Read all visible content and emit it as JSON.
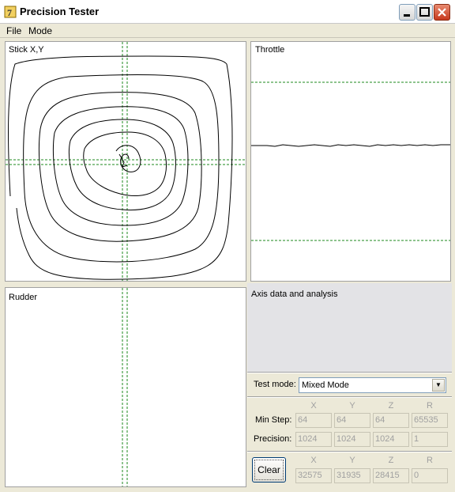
{
  "window": {
    "title": "Precision Tester"
  },
  "menu": {
    "file_label": "File",
    "mode_label": "Mode"
  },
  "panels": {
    "stick_label": "Stick X,Y",
    "throttle_label": "Throttle",
    "rudder_label": "Rudder",
    "analysis_label": "Axis data and analysis"
  },
  "test_mode": {
    "label": "Test mode:",
    "value": "Mixed Mode"
  },
  "columns": [
    "X",
    "Y",
    "Z",
    "R"
  ],
  "stats": {
    "min_step_label": "Min Step:",
    "min_step": [
      "64",
      "64",
      "64",
      "65535"
    ],
    "precision_label": "Precision:",
    "precision": [
      "1024",
      "1024",
      "1024",
      "1"
    ]
  },
  "current": {
    "clear_label": "Clear",
    "values": [
      "32575",
      "31935",
      "28415",
      "0"
    ]
  },
  "colors": {
    "trace": "#000000",
    "guide": "#1e8a1e",
    "title_icon": "#c89b00",
    "close_button": "#c7391d"
  }
}
